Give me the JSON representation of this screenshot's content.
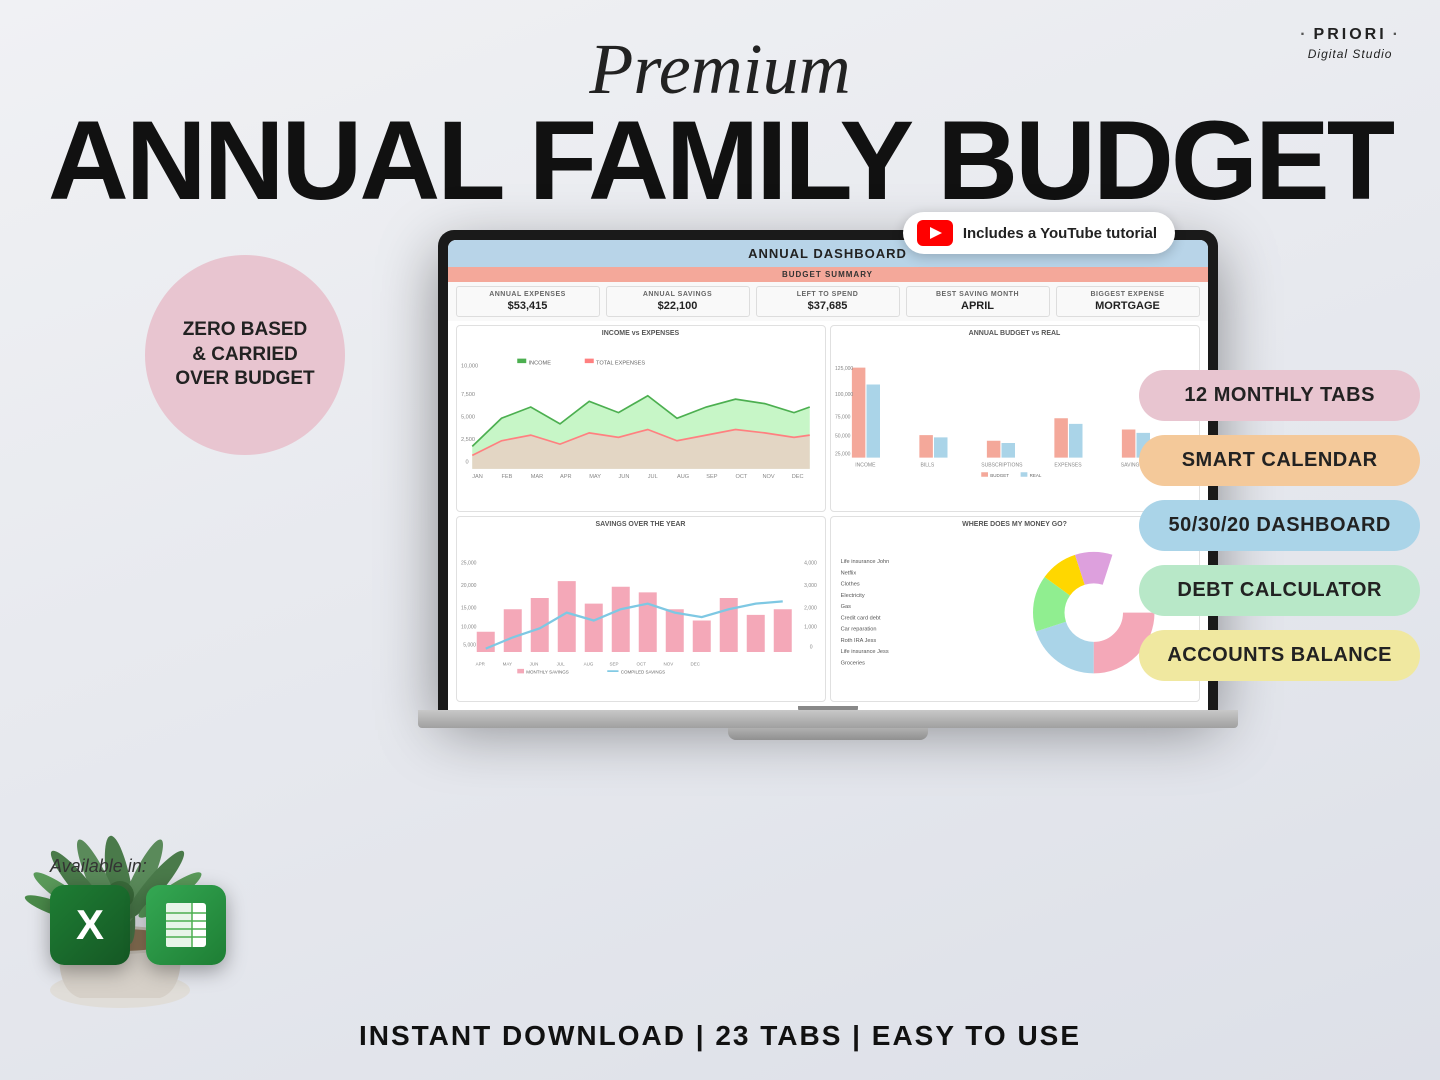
{
  "brand": {
    "name": "PRIORI",
    "sub": "Digital Studio",
    "dot_left": "·",
    "dot_right": "·"
  },
  "heading": {
    "premium": "Premium",
    "main_title": "ANNUAL FAMILY BUDGET"
  },
  "youtube_badge": {
    "text": "Includes a YouTube tutorial"
  },
  "zero_circle": {
    "text": "ZERO BASED\n& CARRIED\nOVER BUDGET"
  },
  "dashboard": {
    "header": "ANNUAL DASHBOARD",
    "budget_summary": "BUDGET SUMMARY",
    "cards": [
      {
        "label": "ANNUAL EXPENSES",
        "value": "$53,415"
      },
      {
        "label": "ANNUAL SAVINGS",
        "value": "$22,100"
      },
      {
        "label": "LEFT TO SPEND",
        "value": "$37,685"
      },
      {
        "label": "BEST SAVING MONTH",
        "value": "APRIL"
      },
      {
        "label": "BIGGEST EXPENSE",
        "value": "MORTGAGE"
      }
    ],
    "charts": [
      {
        "title": "INCOME vs EXPENSES"
      },
      {
        "title": "ANNUAL BUDGET vs REAL"
      },
      {
        "title": "SAVINGS OVER THE YEAR"
      },
      {
        "title": "WHERE DOES MY MONEY GO?"
      }
    ]
  },
  "features": [
    {
      "label": "12 MONTHLY TABS",
      "color": "#e8c5d0"
    },
    {
      "label": "SMART CALENDAR",
      "color": "#f4c99a"
    },
    {
      "label": "50/30/20 DASHBOARD",
      "color": "#aad4e8"
    },
    {
      "label": "DEBT CALCULATOR",
      "color": "#b8e8c8"
    },
    {
      "label": "ACCOUNTS BALANCE",
      "color": "#f0e8a0"
    }
  ],
  "available_in": {
    "label": "Available in:"
  },
  "bottom_bar": {
    "text": "INSTANT DOWNLOAD  |  23 TABS  |  EASY TO USE"
  }
}
